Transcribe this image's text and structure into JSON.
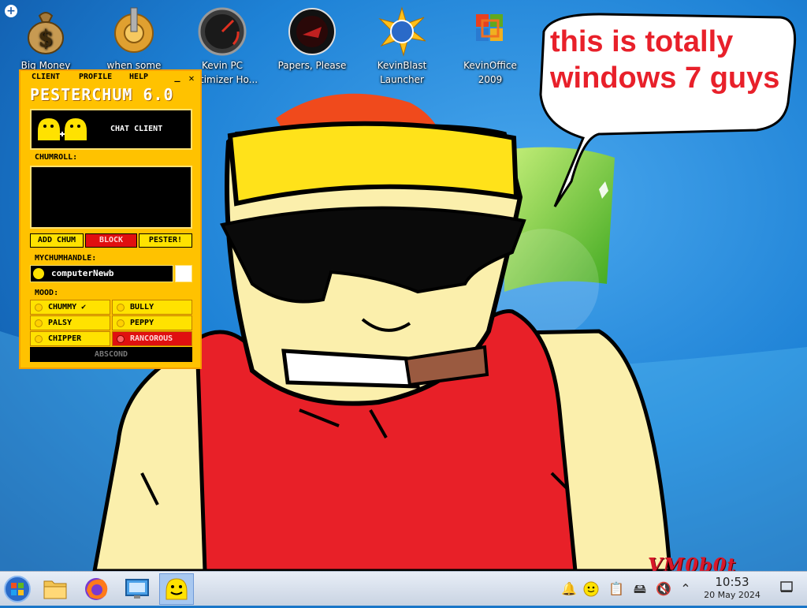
{
  "desktop": {
    "icons": [
      {
        "label": "Big Money",
        "icon": "money-bag-icon"
      },
      {
        "label": "when some",
        "icon": "gear-icon"
      },
      {
        "label": "Kevin PC Optimizer Ho...",
        "icon": "speedometer-icon"
      },
      {
        "label": "Papers, Please",
        "icon": "papers-please-icon"
      },
      {
        "label": "KevinBlast Launcher",
        "icon": "kevinblast-icon"
      },
      {
        "label": "KevinOffice 2009",
        "icon": "office-icon"
      }
    ],
    "speech_bubble": "this is totally windows 7 guys",
    "watermark": "VM0b0t"
  },
  "pesterchum": {
    "menu": {
      "client": "CLIENT",
      "profile": "PROFILE",
      "help": "HELP",
      "minimize": "_",
      "close": "✕"
    },
    "title": "PESTERCHUM 6.0",
    "banner_text": "CHAT CLIENT",
    "chumroll_label": "CHUMROLL:",
    "buttons": {
      "add_chum": "ADD CHUM",
      "block": "BLOCK",
      "pester": "PESTER!"
    },
    "mychumhandle_label": "MYCHUMHANDLE:",
    "handle": "computerNewb",
    "mood_label": "MOOD:",
    "moods": [
      {
        "label": "CHUMMY ✔",
        "selected": true
      },
      {
        "label": "BULLY"
      },
      {
        "label": "PALSY"
      },
      {
        "label": "PEPPY"
      },
      {
        "label": "CHIPPER"
      },
      {
        "label": "RANCOROUS"
      }
    ],
    "abscond": "ABSCOND",
    "colors": {
      "window": "#ffc200",
      "block": "#e01010",
      "rancorous": "#e01010"
    }
  },
  "taskbar": {
    "apps": [
      "start-orb-icon",
      "file-manager-icon",
      "firefox-icon",
      "remote-desktop-icon",
      "pesterchum-icon"
    ],
    "tray": [
      "notification-bell-icon",
      "pesterchum-tray-icon",
      "clipboard-icon",
      "storage-icon",
      "volume-muted-icon",
      "chevron-up-icon",
      "show-desktop-icon"
    ],
    "time": "10:53",
    "date": "20 May 2024"
  }
}
